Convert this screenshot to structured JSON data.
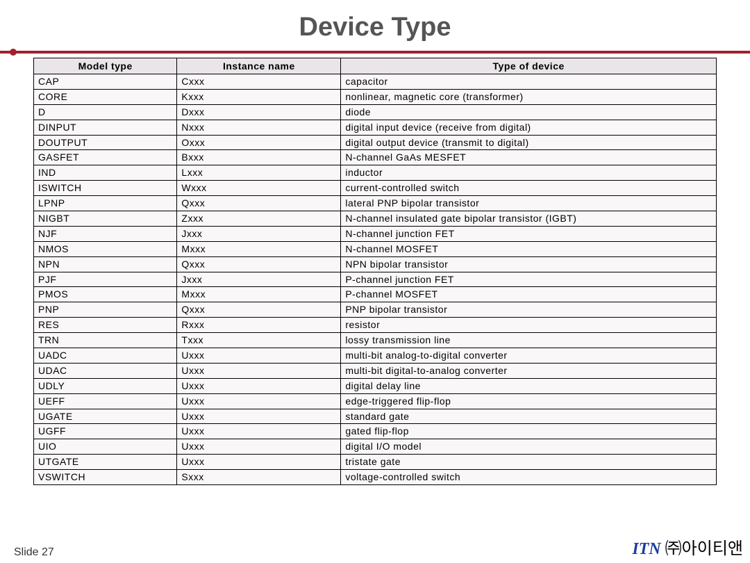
{
  "title": "Device Type",
  "columns": [
    "Model type",
    "Instance name",
    "Type of device"
  ],
  "rows": [
    [
      "CAP",
      "Cxxx",
      "capacitor"
    ],
    [
      "CORE",
      "Kxxx",
      "nonlinear, magnetic core (transformer)"
    ],
    [
      "D",
      "Dxxx",
      "diode"
    ],
    [
      "DINPUT",
      "Nxxx",
      "digital input device (receive from digital)"
    ],
    [
      "DOUTPUT",
      "Oxxx",
      "digital output device (transmit to digital)"
    ],
    [
      "GASFET",
      "Bxxx",
      "N-channel GaAs MESFET"
    ],
    [
      "IND",
      "Lxxx",
      "inductor"
    ],
    [
      "ISWITCH",
      "Wxxx",
      "current-controlled switch"
    ],
    [
      "LPNP",
      "Qxxx",
      "lateral PNP bipolar transistor"
    ],
    [
      "NIGBT",
      "Zxxx",
      "N-channel insulated gate bipolar transistor (IGBT)"
    ],
    [
      "NJF",
      "Jxxx",
      "N-channel junction FET"
    ],
    [
      "NMOS",
      "Mxxx",
      "N-channel MOSFET"
    ],
    [
      "NPN",
      "Qxxx",
      "NPN bipolar transistor"
    ],
    [
      "PJF",
      "Jxxx",
      "P-channel junction FET"
    ],
    [
      "PMOS",
      "Mxxx",
      "P-channel MOSFET"
    ],
    [
      "PNP",
      "Qxxx",
      "PNP bipolar transistor"
    ],
    [
      "RES",
      "Rxxx",
      "resistor"
    ],
    [
      "TRN",
      "Txxx",
      "lossy transmission line"
    ],
    [
      "UADC",
      "Uxxx",
      "multi-bit analog-to-digital converter"
    ],
    [
      "UDAC",
      "Uxxx",
      "multi-bit digital-to-analog converter"
    ],
    [
      "UDLY",
      "Uxxx",
      "digital delay line"
    ],
    [
      "UEFF",
      "Uxxx",
      "edge-triggered flip-flop"
    ],
    [
      "UGATE",
      "Uxxx",
      "standard gate"
    ],
    [
      "UGFF",
      "Uxxx",
      "gated flip-flop"
    ],
    [
      "UIO",
      "Uxxx",
      "digital I/O model"
    ],
    [
      "UTGATE",
      "Uxxx",
      "tristate gate"
    ],
    [
      "VSWITCH",
      "Sxxx",
      "voltage-controlled switch"
    ]
  ],
  "footer": {
    "slide_label": "Slide 27",
    "brand_itn": "ITN ",
    "brand_korean": "㈜아이티앤"
  }
}
